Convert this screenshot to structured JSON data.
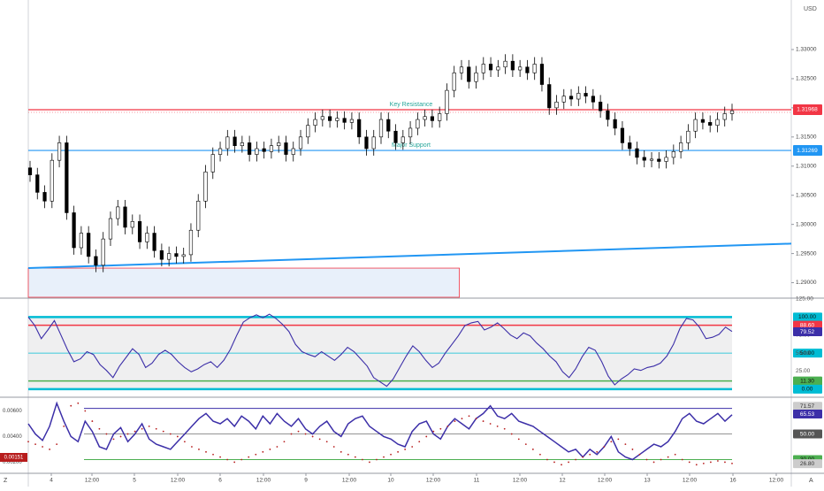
{
  "chart_data": [
    {
      "type": "candlestick",
      "currency": "USD",
      "ylim": [
        1.2875,
        1.3385
      ],
      "y_ticks": [
        "1.29000",
        "1.29500",
        "1.30000",
        "1.30500",
        "1.31000",
        "1.31500",
        "1.32000",
        "1.32500",
        "1.33000"
      ],
      "x_ticks": [
        "4",
        "12:00",
        "5",
        "12:00",
        "6",
        "12:00",
        "9",
        "12:00",
        "10",
        "12:00",
        "11",
        "12:00",
        "12",
        "12:00",
        "13",
        "12:00",
        "16",
        "12:00"
      ],
      "corner_label": "Z",
      "right_corner_label": "A",
      "levels": [
        {
          "name": "Key Resistance",
          "value": 1.31968,
          "color": "#f23645",
          "label": "1.31968"
        },
        {
          "name": "Major Support",
          "value": 1.31269,
          "color": "#2196f3",
          "label": "1.31269"
        }
      ],
      "trendline": {
        "from": [
          0,
          1.2925
        ],
        "to": [
          1,
          1.2967
        ],
        "color": "#2196f3"
      },
      "zone": {
        "top": 1.2925,
        "bottom": 1.2875,
        "x_end_fraction": 0.565
      },
      "candles_close": [
        1.3085,
        1.3055,
        1.304,
        1.311,
        1.314,
        1.302,
        1.296,
        1.2985,
        1.2945,
        1.293,
        1.2975,
        1.301,
        1.303,
        1.2995,
        1.3005,
        1.297,
        1.2985,
        1.2955,
        1.294,
        1.295,
        1.2945,
        1.2948,
        1.299,
        1.304,
        1.309,
        1.312,
        1.313,
        1.315,
        1.3135,
        1.314,
        1.312,
        1.313,
        1.3125,
        1.3135,
        1.314,
        1.312,
        1.313,
        1.315,
        1.317,
        1.318,
        1.3185,
        1.3178,
        1.3182,
        1.3175,
        1.318,
        1.315,
        1.313,
        1.315,
        1.318,
        1.316,
        1.314,
        1.315,
        1.3165,
        1.318,
        1.3185,
        1.3178,
        1.319,
        1.323,
        1.326,
        1.327,
        1.3245,
        1.326,
        1.3275,
        1.3265,
        1.327,
        1.328,
        1.3265,
        1.327,
        1.326,
        1.3275,
        1.324,
        1.32,
        1.321,
        1.322,
        1.3215,
        1.3225,
        1.322,
        1.321,
        1.3195,
        1.318,
        1.3165,
        1.314,
        1.313,
        1.3115,
        1.311,
        1.3112,
        1.3108,
        1.3115,
        1.3125,
        1.314,
        1.316,
        1.318,
        1.3175,
        1.317,
        1.318,
        1.319,
        1.3195
      ],
      "last_price": 1.31968
    },
    {
      "type": "line",
      "name": "oscillator",
      "ylim": [
        -10,
        125
      ],
      "y_ticks": [
        "125.00",
        "75.00",
        "50.00",
        "25.00"
      ],
      "levels": [
        {
          "value": 100,
          "label": "100.00",
          "color": "#00bcd4"
        },
        {
          "value": 88.6,
          "label": "88.60",
          "color": "#f23645"
        },
        {
          "value": 50,
          "label": "50.00",
          "color": "#00bcd4"
        },
        {
          "value": 11.3,
          "label": "11.30",
          "color": "#4caf50"
        },
        {
          "value": 0,
          "label": "0.00",
          "color": "#00bcd4"
        }
      ],
      "current": {
        "value": 79.52,
        "label": "79.52",
        "color": "#3c2fa8"
      },
      "values": [
        100,
        88,
        70,
        82,
        95,
        75,
        55,
        38,
        42,
        52,
        48,
        34,
        26,
        16,
        32,
        44,
        56,
        48,
        30,
        36,
        48,
        54,
        48,
        38,
        30,
        24,
        28,
        34,
        38,
        30,
        40,
        55,
        75,
        93,
        99,
        103,
        99,
        104,
        98,
        90,
        80,
        62,
        52,
        48,
        45,
        52,
        46,
        40,
        48,
        58,
        52,
        42,
        32,
        16,
        10,
        4,
        14,
        30,
        46,
        60,
        52,
        40,
        30,
        36,
        50,
        62,
        74,
        88,
        92,
        94,
        82,
        86,
        92,
        84,
        75,
        70,
        78,
        74,
        64,
        56,
        46,
        38,
        24,
        16,
        28,
        45,
        58,
        54,
        38,
        18,
        6,
        14,
        20,
        28,
        26,
        30,
        32,
        36,
        46,
        62,
        84,
        98,
        96,
        86,
        70,
        72,
        76,
        86,
        80
      ],
      "values_end_fraction": 1.0
    },
    {
      "type": "line",
      "name": "rsi-ema",
      "ylim_left": [
        0.0012,
        0.007
      ],
      "y_ticks_left": [
        "0.00600",
        "0.00400",
        "0.00200"
      ],
      "left_badge": "0.00151",
      "ylim_right": [
        20,
        78
      ],
      "y_ticks_right": [
        "71.57",
        "70.00",
        "65.53",
        "50.00",
        "30.00",
        "26.80"
      ],
      "levels_right": [
        {
          "value": 70,
          "label": "70.00",
          "color": "#3c2fa8"
        },
        {
          "value": 50,
          "label": "50.00",
          "color": "#555555"
        },
        {
          "value": 30,
          "label": "30.00",
          "color": "#4caf50"
        }
      ],
      "markers_right": [
        {
          "value": 71.57,
          "label": "71.57",
          "color": "#cccccc"
        },
        {
          "value": 65.53,
          "label": "65.53",
          "color": "#3c2fa8"
        },
        {
          "value": 26.8,
          "label": "26.80",
          "color": "#cccccc"
        }
      ],
      "series": [
        {
          "name": "",
          "color": "#3c2fa8",
          "style": "solid",
          "values": [
            58,
            50,
            45,
            56,
            74,
            60,
            48,
            44,
            60,
            52,
            40,
            38,
            50,
            55,
            44,
            50,
            58,
            46,
            42,
            40,
            38,
            44,
            50,
            56,
            62,
            66,
            60,
            58,
            62,
            56,
            64,
            60,
            54,
            64,
            58,
            66,
            60,
            56,
            62,
            54,
            50,
            56,
            60,
            52,
            48,
            58,
            62,
            64,
            56,
            52,
            48,
            46,
            42,
            40,
            52,
            58,
            60,
            50,
            46,
            56,
            62,
            58,
            54,
            62,
            66,
            72,
            64,
            62,
            66,
            60,
            58,
            56,
            52,
            48,
            44,
            40,
            36,
            38,
            32,
            38,
            34,
            40,
            48,
            36,
            32,
            30,
            34,
            38,
            42,
            40,
            44,
            52,
            62,
            66,
            60,
            58,
            62,
            66,
            60,
            65
          ]
        },
        {
          "name": "",
          "color": "#b71c1c",
          "style": "dotted",
          "values": [
            44,
            42,
            40,
            38,
            42,
            56,
            72,
            74,
            68,
            60,
            54,
            50,
            46,
            48,
            50,
            52,
            54,
            56,
            54,
            52,
            50,
            48,
            44,
            40,
            38,
            36,
            34,
            32,
            30,
            28,
            30,
            32,
            34,
            36,
            38,
            40,
            44,
            50,
            52,
            50,
            48,
            46,
            44,
            40,
            36,
            34,
            32,
            30,
            28,
            30,
            32,
            34,
            36,
            38,
            40,
            44,
            48,
            52,
            54,
            56,
            60,
            62,
            64,
            62,
            60,
            58,
            56,
            54,
            50,
            46,
            42,
            38,
            34,
            30,
            28,
            26,
            28,
            30,
            32,
            34,
            36,
            40,
            44,
            46,
            42,
            38,
            34,
            30,
            28,
            30,
            32,
            34,
            30,
            28,
            26,
            27,
            28,
            29,
            28,
            27
          ]
        }
      ]
    }
  ]
}
